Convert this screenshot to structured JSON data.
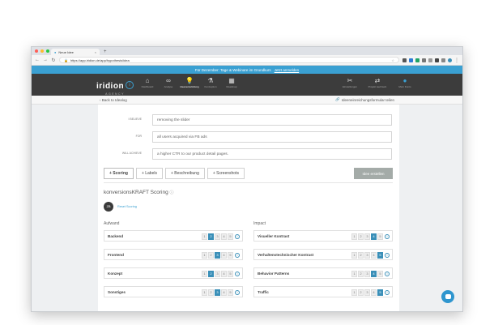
{
  "browser": {
    "tab_title": "Neue Idee",
    "new_tab": "+",
    "url": "https://app.iridion.de/app/hypothesis/idea"
  },
  "banner": {
    "text": "Für Dezember: Tage & Webinare im Grundkurs",
    "link": "Jetzt anmelden"
  },
  "header": {
    "brand": "iridion",
    "brand_sub": "AGENCY",
    "nav": [
      {
        "label": "Dashboard",
        "icon": "house-icon"
      },
      {
        "label": "Analyse",
        "icon": "glasses-icon"
      },
      {
        "label": "Ideenentwicklung",
        "icon": "bulb-icon"
      },
      {
        "label": "Konzeption",
        "icon": "flask-icon"
      },
      {
        "label": "Roadmap",
        "icon": "calendar-icon"
      }
    ],
    "right_nav": [
      {
        "label": "Einstellungen",
        "icon": "tools-icon"
      },
      {
        "label": "Projekt wechseln",
        "icon": "switch-icon"
      },
      {
        "label": "Mein Konto",
        "icon": "user-icon"
      }
    ]
  },
  "subheader": {
    "back": "‹ Back to Idealog",
    "form_link": "Ideeneinreichungsformular teilen"
  },
  "hypothesis": {
    "fields": [
      {
        "label": "I believe",
        "value": "removing the slider"
      },
      {
        "label": "for",
        "value": "all users acquired via FB ads"
      },
      {
        "label": "will achieve",
        "value": "a higher CTR to our product detail pages."
      }
    ]
  },
  "tabs": [
    {
      "label": "+ Scoring",
      "active": true
    },
    {
      "label": "+ Labels",
      "active": false
    },
    {
      "label": "+ Beschreibung",
      "active": false
    },
    {
      "label": "+ Screenshots",
      "active": false
    }
  ],
  "save_label": "Idee erstellen",
  "scoring": {
    "title": "konversionsKRAFT Scoring",
    "avatar_initials": "ZB",
    "reset_label": "Reset Scoring",
    "aufwand": {
      "heading": "Aufwand",
      "rows": [
        {
          "name": "Backend",
          "value": 2
        },
        {
          "name": "Frontend",
          "value": 3
        },
        {
          "name": "Konzept",
          "value": 2
        },
        {
          "name": "Sonstiges",
          "value": 3
        }
      ]
    },
    "impact": {
      "heading": "Impact",
      "rows": [
        {
          "name": "Visueller Kontrast",
          "value": 4
        },
        {
          "name": "Verhaltenstechnischer Kontrast",
          "value": 5
        },
        {
          "name": "Behavior Patterns",
          "value": 4
        },
        {
          "name": "Traffic",
          "value": 5
        }
      ]
    },
    "scale": [
      "1",
      "2",
      "3",
      "4",
      "5"
    ]
  },
  "colors": {
    "accent": "#3a8fb8",
    "banner": "#3aa0d2",
    "header": "#3c3c3c"
  }
}
